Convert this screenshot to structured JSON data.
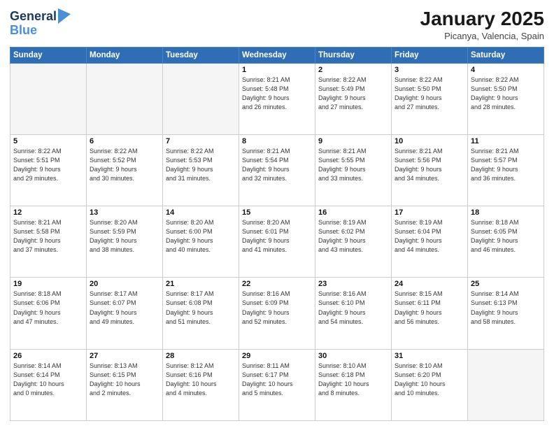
{
  "header": {
    "logo_line1": "General",
    "logo_line2": "Blue",
    "month": "January 2025",
    "location": "Picanya, Valencia, Spain"
  },
  "weekdays": [
    "Sunday",
    "Monday",
    "Tuesday",
    "Wednesday",
    "Thursday",
    "Friday",
    "Saturday"
  ],
  "weeks": [
    [
      {
        "day": "",
        "info": ""
      },
      {
        "day": "",
        "info": ""
      },
      {
        "day": "",
        "info": ""
      },
      {
        "day": "1",
        "info": "Sunrise: 8:21 AM\nSunset: 5:48 PM\nDaylight: 9 hours\nand 26 minutes."
      },
      {
        "day": "2",
        "info": "Sunrise: 8:22 AM\nSunset: 5:49 PM\nDaylight: 9 hours\nand 27 minutes."
      },
      {
        "day": "3",
        "info": "Sunrise: 8:22 AM\nSunset: 5:50 PM\nDaylight: 9 hours\nand 27 minutes."
      },
      {
        "day": "4",
        "info": "Sunrise: 8:22 AM\nSunset: 5:50 PM\nDaylight: 9 hours\nand 28 minutes."
      }
    ],
    [
      {
        "day": "5",
        "info": "Sunrise: 8:22 AM\nSunset: 5:51 PM\nDaylight: 9 hours\nand 29 minutes."
      },
      {
        "day": "6",
        "info": "Sunrise: 8:22 AM\nSunset: 5:52 PM\nDaylight: 9 hours\nand 30 minutes."
      },
      {
        "day": "7",
        "info": "Sunrise: 8:22 AM\nSunset: 5:53 PM\nDaylight: 9 hours\nand 31 minutes."
      },
      {
        "day": "8",
        "info": "Sunrise: 8:21 AM\nSunset: 5:54 PM\nDaylight: 9 hours\nand 32 minutes."
      },
      {
        "day": "9",
        "info": "Sunrise: 8:21 AM\nSunset: 5:55 PM\nDaylight: 9 hours\nand 33 minutes."
      },
      {
        "day": "10",
        "info": "Sunrise: 8:21 AM\nSunset: 5:56 PM\nDaylight: 9 hours\nand 34 minutes."
      },
      {
        "day": "11",
        "info": "Sunrise: 8:21 AM\nSunset: 5:57 PM\nDaylight: 9 hours\nand 36 minutes."
      }
    ],
    [
      {
        "day": "12",
        "info": "Sunrise: 8:21 AM\nSunset: 5:58 PM\nDaylight: 9 hours\nand 37 minutes."
      },
      {
        "day": "13",
        "info": "Sunrise: 8:20 AM\nSunset: 5:59 PM\nDaylight: 9 hours\nand 38 minutes."
      },
      {
        "day": "14",
        "info": "Sunrise: 8:20 AM\nSunset: 6:00 PM\nDaylight: 9 hours\nand 40 minutes."
      },
      {
        "day": "15",
        "info": "Sunrise: 8:20 AM\nSunset: 6:01 PM\nDaylight: 9 hours\nand 41 minutes."
      },
      {
        "day": "16",
        "info": "Sunrise: 8:19 AM\nSunset: 6:02 PM\nDaylight: 9 hours\nand 43 minutes."
      },
      {
        "day": "17",
        "info": "Sunrise: 8:19 AM\nSunset: 6:04 PM\nDaylight: 9 hours\nand 44 minutes."
      },
      {
        "day": "18",
        "info": "Sunrise: 8:18 AM\nSunset: 6:05 PM\nDaylight: 9 hours\nand 46 minutes."
      }
    ],
    [
      {
        "day": "19",
        "info": "Sunrise: 8:18 AM\nSunset: 6:06 PM\nDaylight: 9 hours\nand 47 minutes."
      },
      {
        "day": "20",
        "info": "Sunrise: 8:17 AM\nSunset: 6:07 PM\nDaylight: 9 hours\nand 49 minutes."
      },
      {
        "day": "21",
        "info": "Sunrise: 8:17 AM\nSunset: 6:08 PM\nDaylight: 9 hours\nand 51 minutes."
      },
      {
        "day": "22",
        "info": "Sunrise: 8:16 AM\nSunset: 6:09 PM\nDaylight: 9 hours\nand 52 minutes."
      },
      {
        "day": "23",
        "info": "Sunrise: 8:16 AM\nSunset: 6:10 PM\nDaylight: 9 hours\nand 54 minutes."
      },
      {
        "day": "24",
        "info": "Sunrise: 8:15 AM\nSunset: 6:11 PM\nDaylight: 9 hours\nand 56 minutes."
      },
      {
        "day": "25",
        "info": "Sunrise: 8:14 AM\nSunset: 6:13 PM\nDaylight: 9 hours\nand 58 minutes."
      }
    ],
    [
      {
        "day": "26",
        "info": "Sunrise: 8:14 AM\nSunset: 6:14 PM\nDaylight: 10 hours\nand 0 minutes."
      },
      {
        "day": "27",
        "info": "Sunrise: 8:13 AM\nSunset: 6:15 PM\nDaylight: 10 hours\nand 2 minutes."
      },
      {
        "day": "28",
        "info": "Sunrise: 8:12 AM\nSunset: 6:16 PM\nDaylight: 10 hours\nand 4 minutes."
      },
      {
        "day": "29",
        "info": "Sunrise: 8:11 AM\nSunset: 6:17 PM\nDaylight: 10 hours\nand 5 minutes."
      },
      {
        "day": "30",
        "info": "Sunrise: 8:10 AM\nSunset: 6:18 PM\nDaylight: 10 hours\nand 8 minutes."
      },
      {
        "day": "31",
        "info": "Sunrise: 8:10 AM\nSunset: 6:20 PM\nDaylight: 10 hours\nand 10 minutes."
      },
      {
        "day": "",
        "info": ""
      }
    ]
  ]
}
